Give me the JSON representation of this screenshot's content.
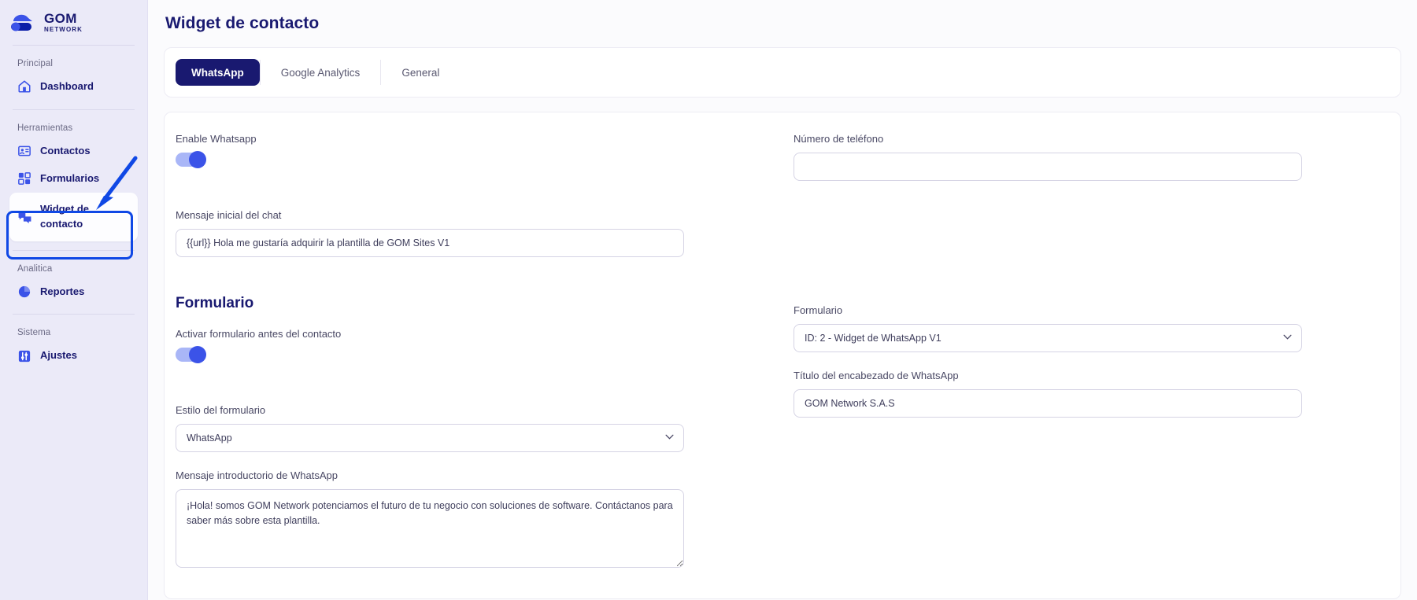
{
  "brand": {
    "name_top": "GOM",
    "name_bottom": "NETWORK",
    "logo_icon": "gom-cloud-logo",
    "accent": "#3b53e8",
    "navy": "#191970"
  },
  "sidebar": {
    "groups": [
      {
        "label": "Principal",
        "items": [
          {
            "label": "Dashboard",
            "icon": "home-icon",
            "active": false
          }
        ]
      },
      {
        "label": "Herramientas",
        "items": [
          {
            "label": "Contactos",
            "icon": "contact-card-icon",
            "active": false
          },
          {
            "label": "Formularios",
            "icon": "form-grid-icon",
            "active": false
          },
          {
            "label": "Widget de contacto",
            "icon": "chat-bubbles-icon",
            "active": true
          }
        ]
      },
      {
        "label": "Analitica",
        "items": [
          {
            "label": "Reportes",
            "icon": "pie-chart-icon",
            "active": false
          }
        ]
      },
      {
        "label": "Sistema",
        "items": [
          {
            "label": "Ajustes",
            "icon": "sliders-icon",
            "active": false
          }
        ]
      }
    ],
    "annotation": {
      "highlight_color": "#1048e5",
      "arrow_icon": "arrow-pointer"
    }
  },
  "header": {
    "title": "Widget de contacto"
  },
  "tabs": [
    {
      "label": "WhatsApp",
      "active": true
    },
    {
      "label": "Google Analytics",
      "active": false
    },
    {
      "label": "General",
      "active": false
    }
  ],
  "form": {
    "enable_whatsapp": {
      "label": "Enable Whatsapp",
      "value": "on"
    },
    "phone": {
      "label": "Número de teléfono",
      "value": "",
      "placeholder": ""
    },
    "initial_chat_message": {
      "label": "Mensaje inicial del chat",
      "value": "{{url}} Hola me gustaría adquirir la plantilla de GOM Sites V1"
    },
    "section_title": "Formulario",
    "activate_form_before_contact": {
      "label": "Activar formulario antes del contacto",
      "value": "on"
    },
    "formulario_select": {
      "label": "Formulario",
      "value": "ID: 2 - Widget de WhatsApp V1",
      "chevron": "chevron-down-icon"
    },
    "form_style_select": {
      "label": "Estilo del formulario",
      "value": "WhatsApp",
      "chevron": "chevron-down-icon"
    },
    "whatsapp_header_title": {
      "label": "Título del encabezado de WhatsApp",
      "value": "GOM Network S.A.S"
    },
    "whatsapp_intro_message": {
      "label": "Mensaje introductorio de WhatsApp",
      "value": "¡Hola! somos GOM Network potenciamos el futuro de tu negocio con soluciones de software. Contáctanos para saber más sobre esta plantilla."
    }
  }
}
